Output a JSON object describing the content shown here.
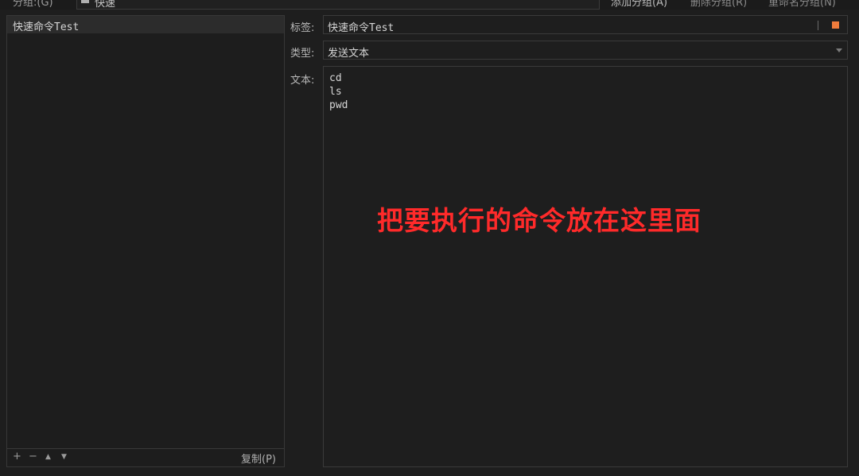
{
  "top": {
    "group_label": "分组:(G)",
    "group_value": "快速",
    "add_group": "添加分组(A)",
    "delete_group": "删除分组(R)",
    "rename_group": "重命名分组(N)"
  },
  "list": {
    "items": [
      {
        "label": "快速命令Test"
      }
    ],
    "footer": {
      "add": "+",
      "remove": "−",
      "up": "▲",
      "down": "▼",
      "copy": "复制(P)"
    }
  },
  "form": {
    "tag_label": "标签:",
    "tag_value": "快速命令Test",
    "tag_color": "#f07c3c",
    "type_label": "类型:",
    "type_value": "发送文本",
    "text_label": "文本:",
    "text_lines": [
      "cd",
      "ls",
      "pwd"
    ]
  },
  "annotation": "把要执行的命令放在这里面"
}
